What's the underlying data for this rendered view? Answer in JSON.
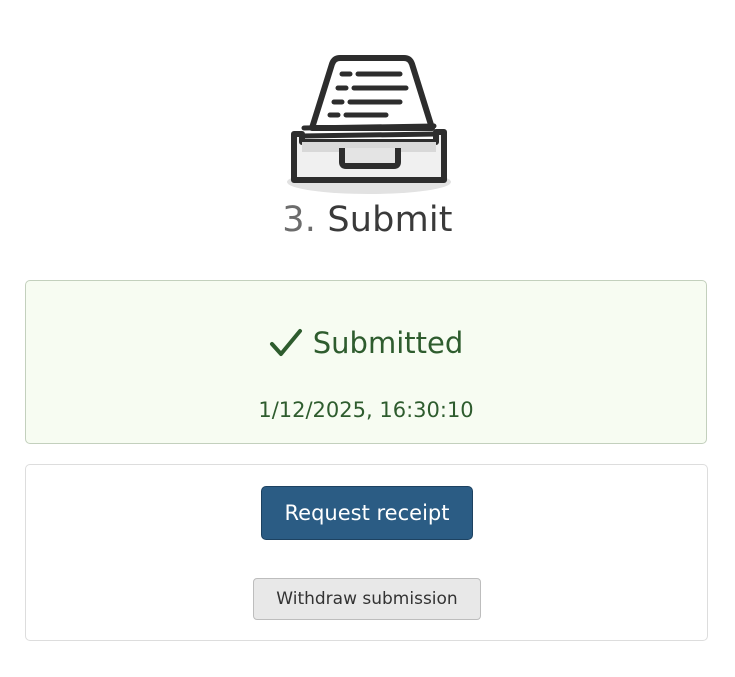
{
  "step": {
    "number": "3.",
    "title": "Submit",
    "illustration_icon": "inbox-tray-icon"
  },
  "status": {
    "icon": "checkmark-icon",
    "label": "Submitted",
    "timestamp": "1/12/2025, 16:30:10",
    "text_color": "#2e5c2e",
    "background_color": "#f7fcf2"
  },
  "actions": {
    "request_receipt_label": "Request receipt",
    "withdraw_label": "Withdraw submission",
    "primary_color": "#2b5c84"
  }
}
